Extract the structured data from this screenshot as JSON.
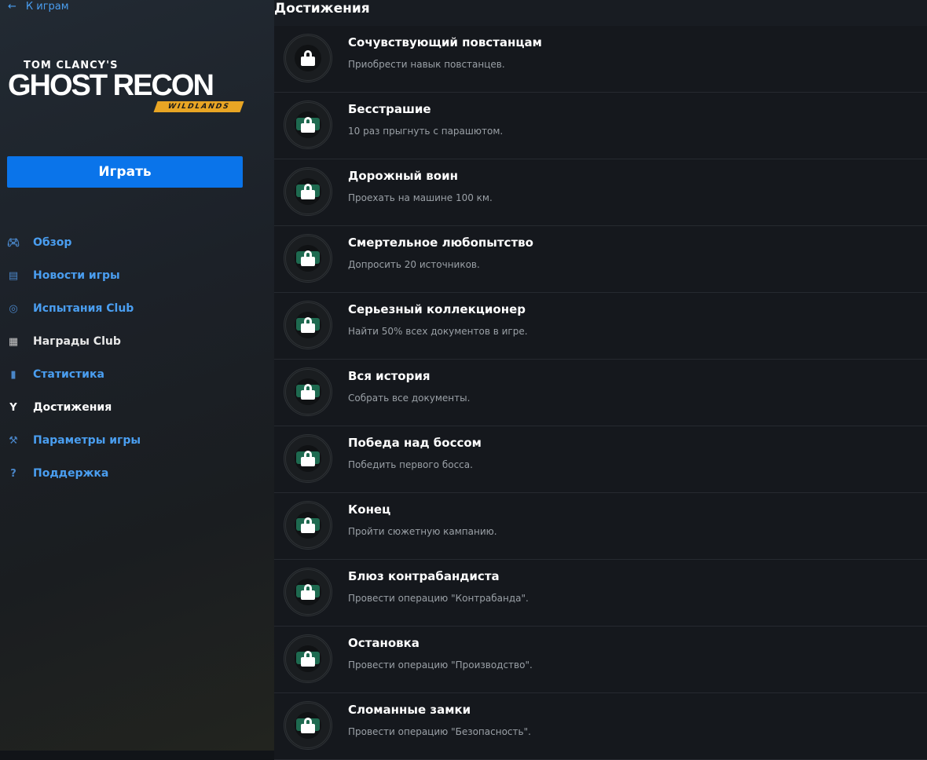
{
  "sidebar": {
    "back_label": "К играм",
    "logo": {
      "line1": "TOM CLANCY'S",
      "line2": "GHOST RECON",
      "line3": "WILDLANDS"
    },
    "play_label": "Играть",
    "items": [
      {
        "label": "Обзор",
        "icon": "gamepad-icon",
        "state": "link"
      },
      {
        "label": "Новости игры",
        "icon": "news-icon",
        "state": "link"
      },
      {
        "label": "Испытания Club",
        "icon": "target-icon",
        "state": "link"
      },
      {
        "label": "Награды Club",
        "icon": "gift-icon",
        "state": "white"
      },
      {
        "label": "Статистика",
        "icon": "bar-chart-icon",
        "state": "link"
      },
      {
        "label": "Достижения",
        "icon": "medal-icon",
        "state": "active"
      },
      {
        "label": "Параметры игры",
        "icon": "wrench-icon",
        "state": "link"
      },
      {
        "label": "Поддержка",
        "icon": "help-icon",
        "state": "link"
      }
    ]
  },
  "main": {
    "title": "Достижения",
    "achievements": [
      {
        "name": "Сочувствующий повстанцам",
        "desc": "Приобрести навык повстанцев."
      },
      {
        "name": "Бесстрашие",
        "desc": "10 раз прыгнуть с парашютом."
      },
      {
        "name": "Дорожный воин",
        "desc": "Проехать на машине 100 км."
      },
      {
        "name": "Смертельное любопытство",
        "desc": "Допросить 20 источников."
      },
      {
        "name": "Серьезный коллекционер",
        "desc": "Найти 50% всех документов в игре."
      },
      {
        "name": "Вся история",
        "desc": "Собрать все документы."
      },
      {
        "name": "Победа над боссом",
        "desc": "Победить первого босса."
      },
      {
        "name": "Конец",
        "desc": "Пройти сюжетную кампанию."
      },
      {
        "name": "Блюз контрабандиста",
        "desc": "Провести операцию \"Контрабанда\"."
      },
      {
        "name": "Остановка",
        "desc": "Провести операцию \"Производство\"."
      },
      {
        "name": "Сломанные замки",
        "desc": "Провести операцию \"Безопасность\"."
      }
    ]
  }
}
